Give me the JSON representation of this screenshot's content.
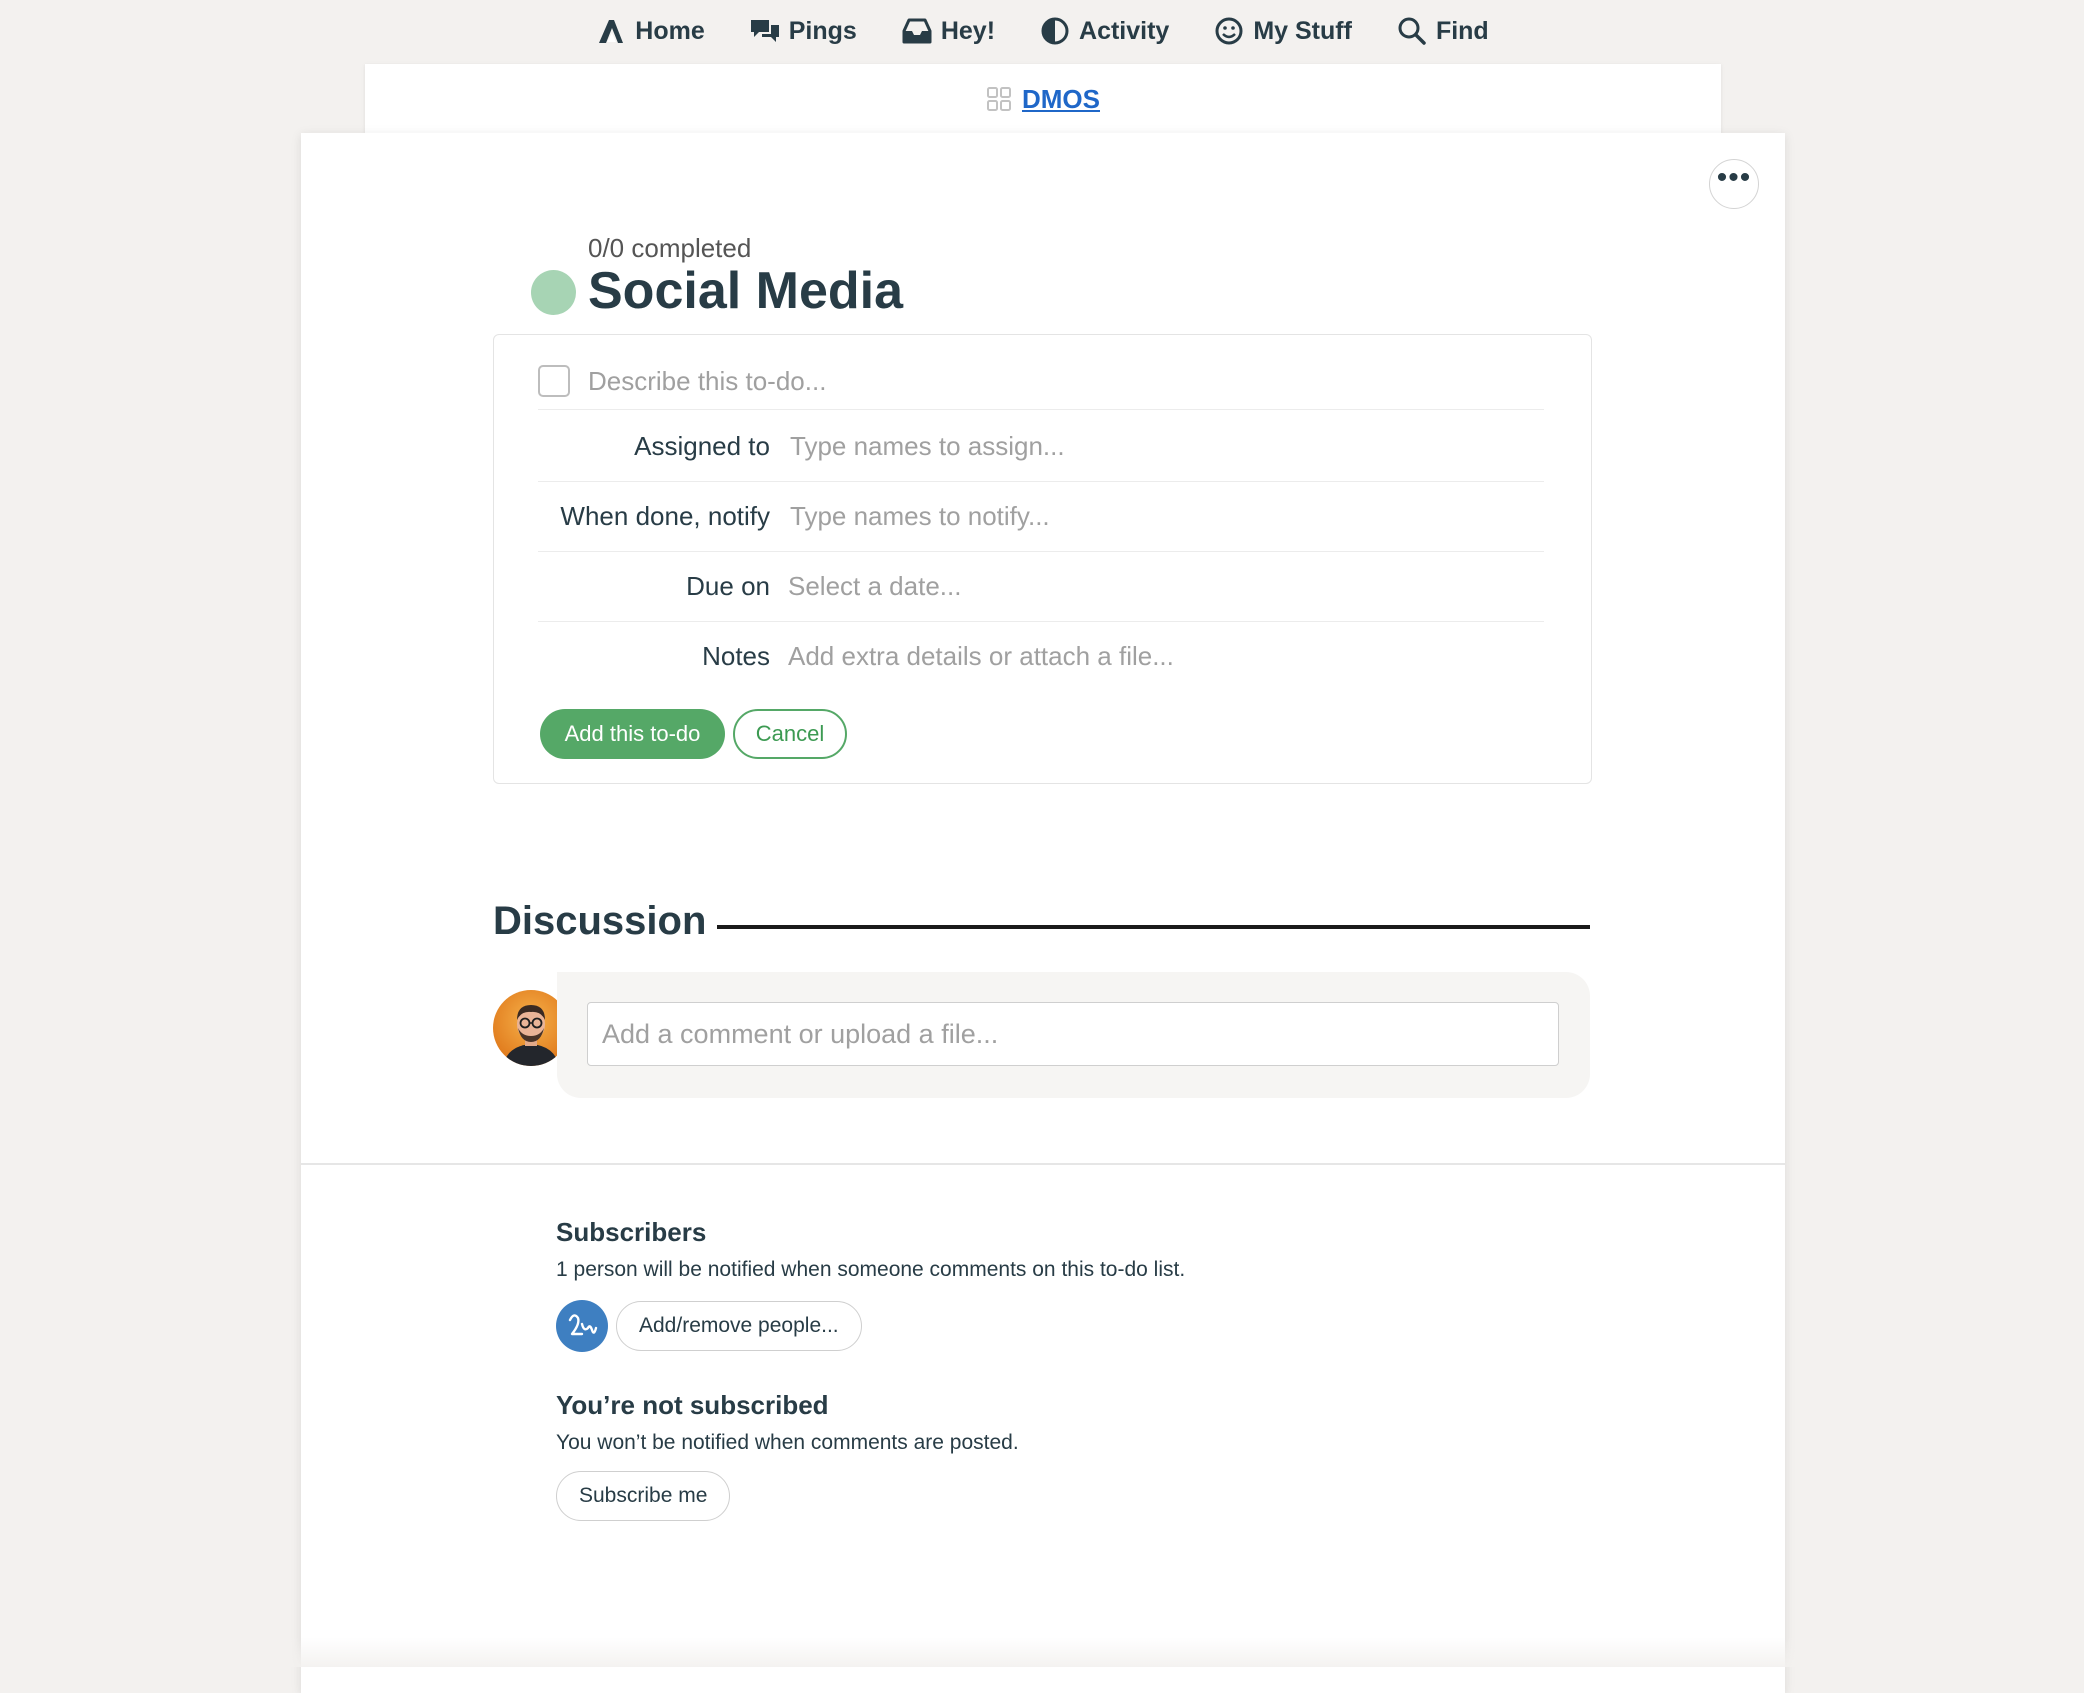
{
  "nav": {
    "items": [
      {
        "label": "Home",
        "icon": "home-icon"
      },
      {
        "label": "Pings",
        "icon": "pings-icon"
      },
      {
        "label": "Hey!",
        "icon": "hey-icon"
      },
      {
        "label": "Activity",
        "icon": "activity-icon"
      },
      {
        "label": "My Stuff",
        "icon": "my-stuff-icon"
      },
      {
        "label": "Find",
        "icon": "search-icon"
      }
    ]
  },
  "project": {
    "name": "DMOS",
    "icon": "grid-icon"
  },
  "todolist": {
    "completed": "0/0 completed",
    "title": "Social Media",
    "status_color": "#a7d4b4"
  },
  "form": {
    "todo_placeholder": "Describe this to-do...",
    "assigned_label": "Assigned to",
    "assigned_placeholder": "Type names to assign...",
    "notify_label": "When done, notify",
    "notify_placeholder": "Type names to notify...",
    "due_label": "Due on",
    "due_placeholder": "Select a date...",
    "notes_label": "Notes",
    "notes_placeholder": "Add extra details or attach a file...",
    "add_button": "Add this to-do",
    "cancel_button": "Cancel"
  },
  "discussion": {
    "title": "Discussion",
    "comment_placeholder": "Add a comment or upload a file..."
  },
  "subscribers": {
    "title": "Subscribers",
    "description": "1 person will be notified when someone comments on this to-do list.",
    "button": "Add/remove people..."
  },
  "subscription": {
    "title": "You’re not subscribed",
    "description": "You won’t be notified when comments are posted.",
    "button": "Subscribe me"
  },
  "colors": {
    "accent_green": "#55a867",
    "link_blue": "#1f67c8",
    "avatar_blue": "#3e7fc1"
  }
}
